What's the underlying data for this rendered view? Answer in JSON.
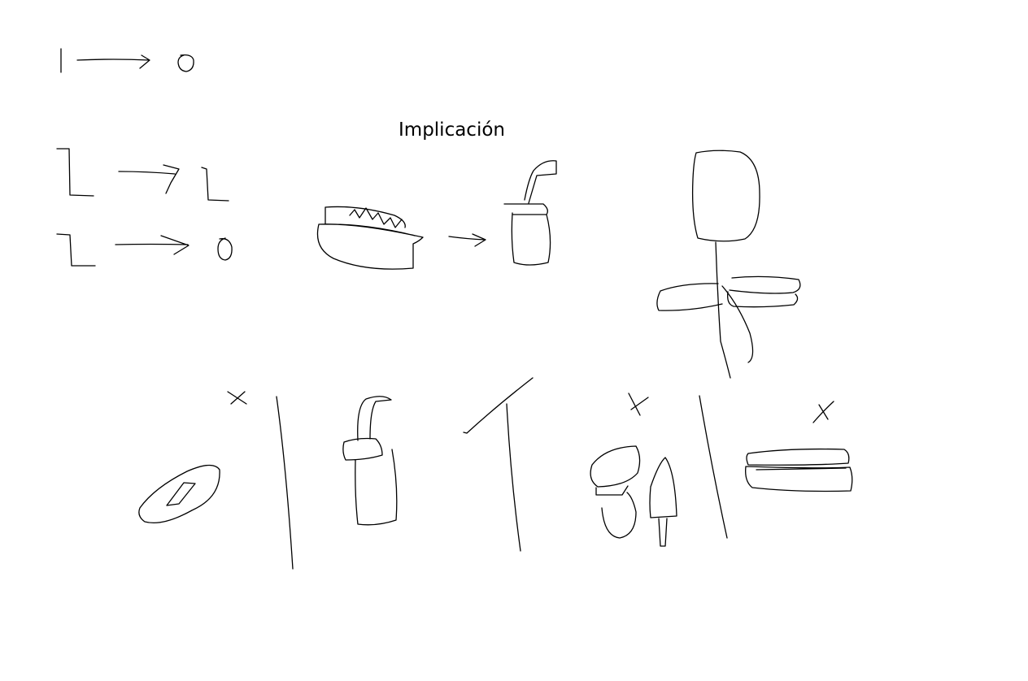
{
  "canvas": {
    "background": "#ffffff",
    "ink_color": "#000000"
  },
  "title": "Implicación",
  "sketches": [
    {
      "name": "rule-1-to-0",
      "icon": "arrow-icon"
    },
    {
      "name": "rule-1-to-1",
      "icon": "arrow-icon"
    },
    {
      "name": "rule-1-to-0-second",
      "icon": "arrow-icon"
    },
    {
      "name": "sandwich-to-drink",
      "icon": "sandwich-icon"
    },
    {
      "name": "flower-plant",
      "icon": "flower-icon"
    },
    {
      "name": "mark-x-1",
      "icon": "cross-mark-icon"
    },
    {
      "name": "mark-check",
      "icon": "check-mark-icon"
    },
    {
      "name": "mark-x-2",
      "icon": "cross-mark-icon"
    },
    {
      "name": "mark-x-3",
      "icon": "cross-mark-icon"
    }
  ]
}
